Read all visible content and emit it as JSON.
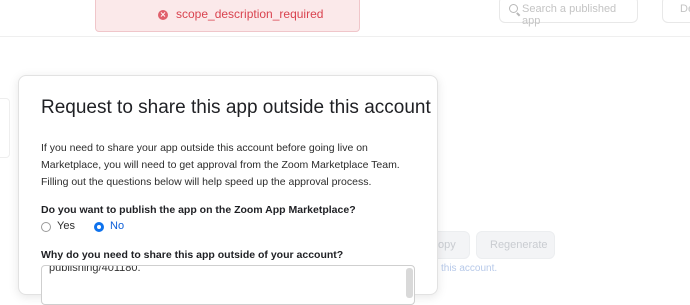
{
  "toast": {
    "message": "scope_description_required",
    "icon": "error-x-icon",
    "color": "#d9434f"
  },
  "header": {
    "search_placeholder": "Search a published app",
    "button_label": "De"
  },
  "background": {
    "copy_label": "opy",
    "regenerate_label": "Regenerate",
    "note": "this account."
  },
  "modal": {
    "title": "Request to share this app outside this account",
    "description": "If you need to share your app outside this account before going live on Marketplace, you will need to get approval from the Zoom Marketplace Team. Filling out the questions below will help speed up the approval process.",
    "question1": "Do you want to publish the app on the Zoom App Marketplace?",
    "options": [
      {
        "label": "Yes",
        "selected": false
      },
      {
        "label": "No",
        "selected": true
      }
    ],
    "question2": "Why do you need to share this app outside of your account?",
    "answer_value": "publishing/401180."
  },
  "colors": {
    "accent": "#0e72ed",
    "error": "#d9434f"
  }
}
